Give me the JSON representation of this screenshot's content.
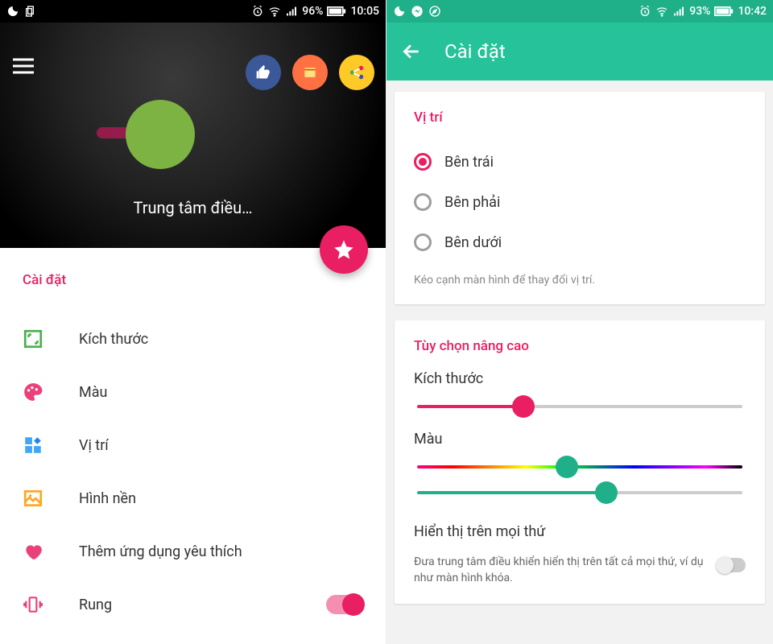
{
  "left": {
    "status": {
      "battery": "96%",
      "time": "10:05"
    },
    "caption": "Trung tâm điều…",
    "section_title": "Cài đặt",
    "items": [
      {
        "label": "Kích thước"
      },
      {
        "label": "Màu"
      },
      {
        "label": "Vị trí"
      },
      {
        "label": "Hình nền"
      },
      {
        "label": "Thêm ứng dụng yêu thích"
      },
      {
        "label": "Rung"
      }
    ]
  },
  "right": {
    "status": {
      "battery": "93%",
      "time": "10:42"
    },
    "appbar_title": "Cài đặt",
    "position": {
      "title": "Vị trí",
      "options": [
        "Bên trái",
        "Bên phải",
        "Bên dưới"
      ],
      "hint": "Kéo cạnh màn hình để thay đổi vị trí."
    },
    "advanced": {
      "title": "Tùy chọn nâng cao",
      "size_label": "Kích thước",
      "color_label": "Màu",
      "overlay_title": "Hiển thị trên mọi thứ",
      "overlay_desc": "Đưa trung tâm điều khiển hiển thị trên tất cả mọi thứ, ví dụ như màn hình khóa."
    }
  }
}
